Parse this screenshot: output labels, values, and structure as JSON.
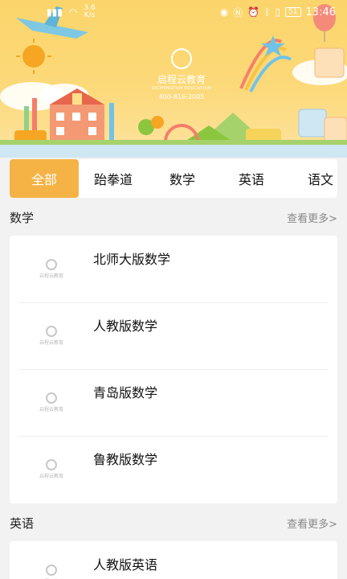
{
  "status_bar": {
    "speed_value": "3.6",
    "speed_unit": "K/s",
    "battery": "51",
    "time": "13:46"
  },
  "banner": {
    "brand_name": "启程云教育",
    "brand_en": "QICHENGYUN EDUCATION",
    "phone": "400-816-2005",
    "colors": {
      "sky": "#fbd56b",
      "accent": "#f5b346"
    }
  },
  "tabs": [
    {
      "label": "全部",
      "active": true
    },
    {
      "label": "跆拳道",
      "active": false
    },
    {
      "label": "数学",
      "active": false
    },
    {
      "label": "英语",
      "active": false
    },
    {
      "label": "语文",
      "active": false
    }
  ],
  "sections": [
    {
      "title": "数学",
      "more": "查看更多>",
      "items": [
        {
          "title": "北师大版数学"
        },
        {
          "title": "人教版数学"
        },
        {
          "title": "青岛版数学"
        },
        {
          "title": "鲁教版数学"
        }
      ]
    },
    {
      "title": "英语",
      "more": "查看更多>",
      "items": [
        {
          "title": "人教版英语"
        }
      ]
    }
  ],
  "thumb_logo_text": "启程云教育"
}
